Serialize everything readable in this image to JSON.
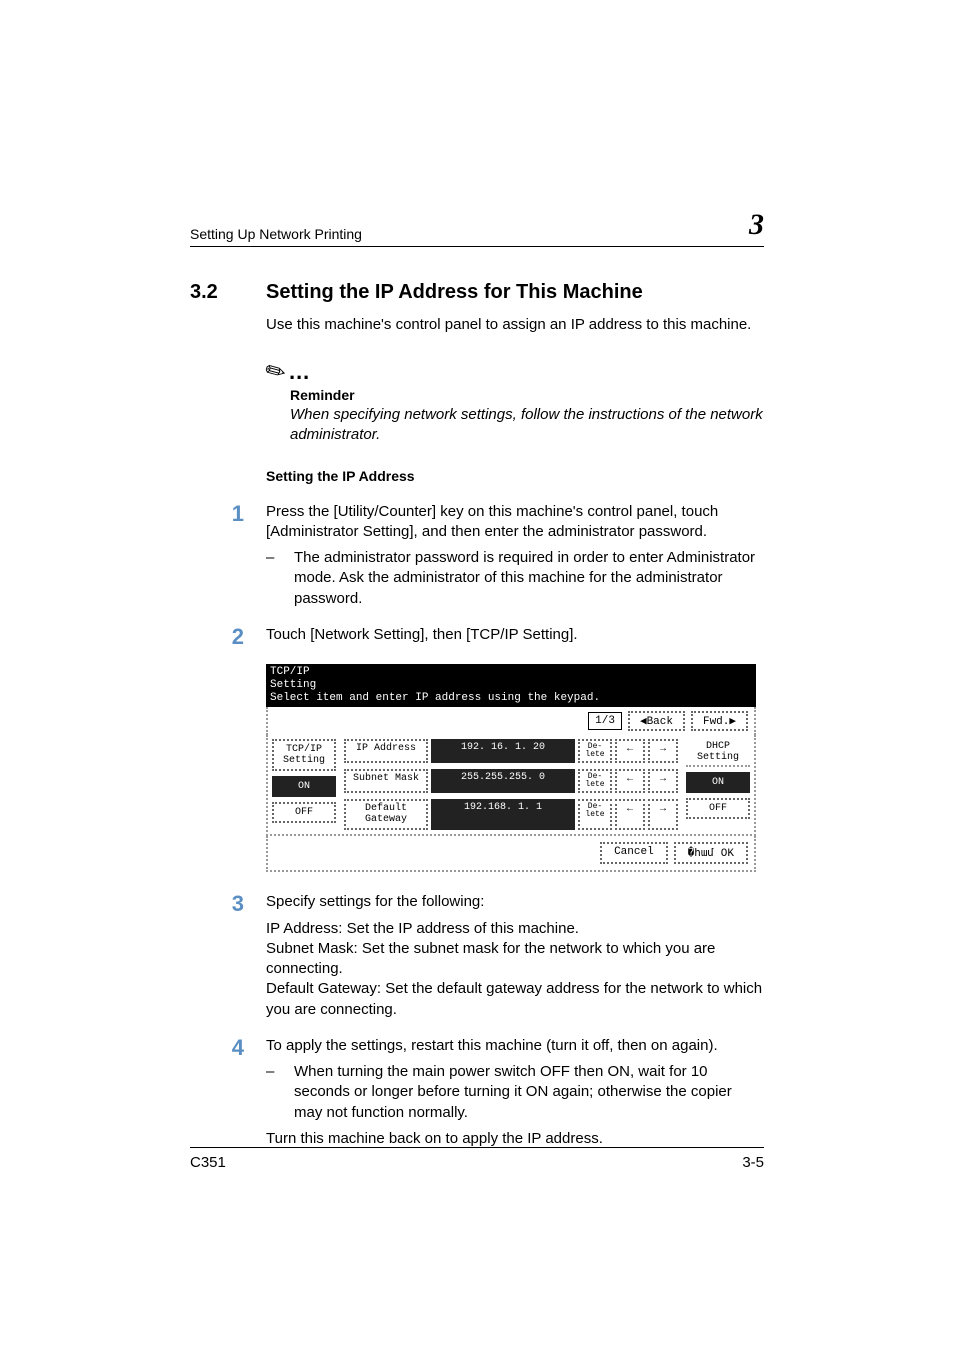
{
  "header": {
    "running_title": "Setting Up Network Printing",
    "chapter_number": "3"
  },
  "section": {
    "number": "3.2",
    "title": "Setting the IP Address for This Machine",
    "intro": "Use this machine's control panel to assign an IP address to this machine."
  },
  "note": {
    "title": "Reminder",
    "body": "When specifying network settings, follow the instructions of the network administrator."
  },
  "subheading": "Setting the IP Address",
  "steps": [
    {
      "n": "1",
      "text": "Press the [Utility/Counter] key on this machine's control panel, touch [Administrator Setting], and then enter the administrator password.",
      "sub": [
        "The administrator password is required in order to enter Administrator mode. Ask the administrator of this machine for the administrator password."
      ]
    },
    {
      "n": "2",
      "text": "Touch [Network Setting], then [TCP/IP Setting]."
    },
    {
      "n": "3",
      "text": "Specify settings for the following:",
      "after": [
        "IP Address: Set the IP address of this machine.",
        "Subnet Mask: Set the subnet mask for the network to which you are connecting.",
        "Default Gateway: Set the default gateway address for the network to which you are connecting."
      ]
    },
    {
      "n": "4",
      "text": "To apply the settings, restart this machine (turn it off, then on again).",
      "sub": [
        "When turning the main power switch OFF then ON, wait for 10 seconds or longer before turning it ON again; otherwise the copier may not function normally."
      ],
      "after_single": "Turn this machine back on to apply the IP address."
    }
  ],
  "figure": {
    "title_line1": "TCP/IP",
    "title_line2": "Setting",
    "instruction": "Select item and enter IP address using the keypad.",
    "page": "1/3",
    "back": "Back",
    "fwd": "Fwd.",
    "left_label": "TCP/IP\nSetting",
    "left_on": "ON",
    "left_off": "OFF",
    "rows": [
      {
        "label": "IP Address",
        "value": "192. 16.  1. 20",
        "del": "De-\nlete",
        "l": "←",
        "r": "→"
      },
      {
        "label": "Subnet Mask",
        "value": "255.255.255.  0",
        "del": "De-\nlete",
        "l": "←",
        "r": "→"
      },
      {
        "label": "Default\nGateway",
        "value": "192.168.  1.  1",
        "del": "De-\nlete",
        "l": "←",
        "r": "→"
      }
    ],
    "dhcp_label": "DHCP Setting",
    "dhcp_on": "ON",
    "dhcp_off": "OFF",
    "cancel": "Cancel",
    "ok": "OK"
  },
  "footer": {
    "model": "C351",
    "page": "3-5"
  }
}
